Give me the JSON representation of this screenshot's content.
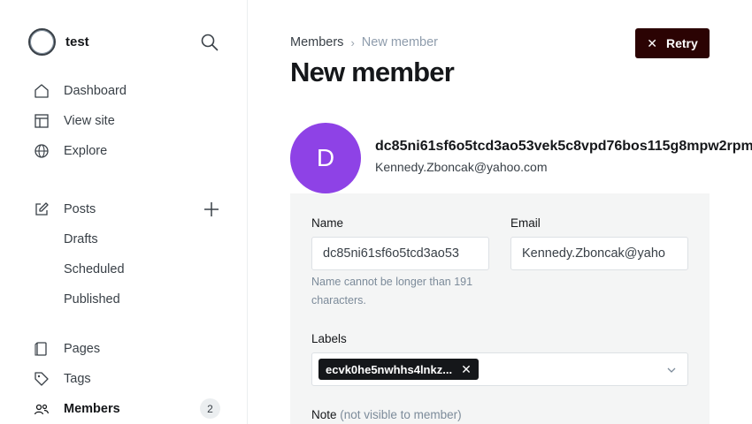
{
  "sidebar": {
    "site_name": "test",
    "items": [
      {
        "label": "Dashboard",
        "icon": "home-icon"
      },
      {
        "label": "View site",
        "icon": "layout-icon"
      },
      {
        "label": "Explore",
        "icon": "globe-icon"
      },
      {
        "label": "Posts",
        "icon": "edit-icon"
      },
      {
        "label": "Drafts"
      },
      {
        "label": "Scheduled"
      },
      {
        "label": "Published"
      },
      {
        "label": "Pages",
        "icon": "page-icon"
      },
      {
        "label": "Tags",
        "icon": "tag-icon"
      },
      {
        "label": "Members",
        "icon": "members-icon",
        "count": "2"
      }
    ]
  },
  "breadcrumb": {
    "parent": "Members",
    "current": "New member"
  },
  "page": {
    "title": "New member",
    "retry_label": "Retry"
  },
  "member": {
    "initial": "D",
    "name": "dc85ni61sf6o5tcd3ao53vek5c8vpd76bos115g8mpw2rpm",
    "email": "Kennedy.Zboncak@yahoo.com",
    "avatar_color": "#8e42e6"
  },
  "form": {
    "name_label": "Name",
    "name_value": "dc85ni61sf6o5tcd3ao53",
    "name_error": "Name cannot be longer than 191 characters.",
    "email_label": "Email",
    "email_value": "Kennedy.Zboncak@yaho",
    "labels_label": "Labels",
    "label_chip": "ecvk0he5nwhhs4lnkz...",
    "note_label": "Note",
    "note_hint": "(not visible to member)"
  },
  "colors": {
    "retry_bg": "#2b0303",
    "panel_bg": "#f4f5f5"
  }
}
